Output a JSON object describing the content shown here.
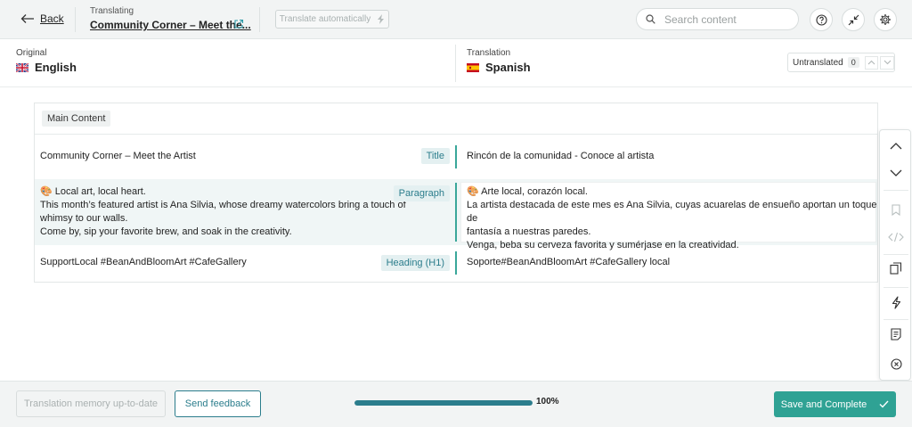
{
  "header": {
    "back_label": "Back",
    "translating_label": "Translating",
    "entry_title": "Community Corner – Meet the...",
    "translate_auto_label": "Translate automatically",
    "search_placeholder": "Search content"
  },
  "languages": {
    "source_heading": "Original",
    "source_name": "English",
    "target_heading": "Translation",
    "target_name": "Spanish",
    "filter_label": "Untranslated",
    "filter_count": "0"
  },
  "content": {
    "section_label": "Main Content",
    "rows": [
      {
        "source": "Community Corner – Meet the Artist",
        "type": "Title",
        "target": "Rincón de la comunidad - Conoce al artista"
      },
      {
        "source_lines": [
          "🎨 Local art, local heart.",
          "This month’s featured artist is Ana Silvia, whose dreamy watercolors bring a touch of",
          "whimsy to our walls.",
          "Come by, sip your favorite brew, and soak in the creativity."
        ],
        "type": "Paragraph",
        "target_lines": [
          "🎨 Arte local, corazón local.",
          "La artista destacada de este mes es Ana Silvia, cuyas acuarelas de ensueño aportan un toque de",
          "fantasía a nuestras paredes.",
          "Venga, beba su cerveza favorita y sumérjase en la creatividad."
        ]
      },
      {
        "source": "SupportLocal #BeanAndBloomArt #CafeGallery",
        "type": "Heading (H1)",
        "target": "Soporte#BeanAndBloomArt #CafeGallery local"
      }
    ]
  },
  "footer": {
    "memory_label": "Translation memory up-to-date",
    "feedback_label": "Send feedback",
    "progress_value": 100,
    "progress_label": "100%",
    "save_label": "Save and Complete"
  },
  "colors": {
    "accent": "#2b7d8c",
    "primary_button": "#2fa294",
    "row_bar": "#3aa79a"
  },
  "icons": {
    "back": "arrow-left-icon",
    "external": "external-link-icon",
    "bolt": "lightning-icon",
    "search": "search-icon",
    "help": "help-icon",
    "collapse": "collapse-icon",
    "settings": "gear-icon",
    "rail": [
      "chevron-up-icon",
      "chevron-down-icon",
      "bookmark-icon",
      "code-icon",
      "copy-icon",
      "lightning-icon",
      "notes-icon",
      "close-circle-icon"
    ]
  }
}
